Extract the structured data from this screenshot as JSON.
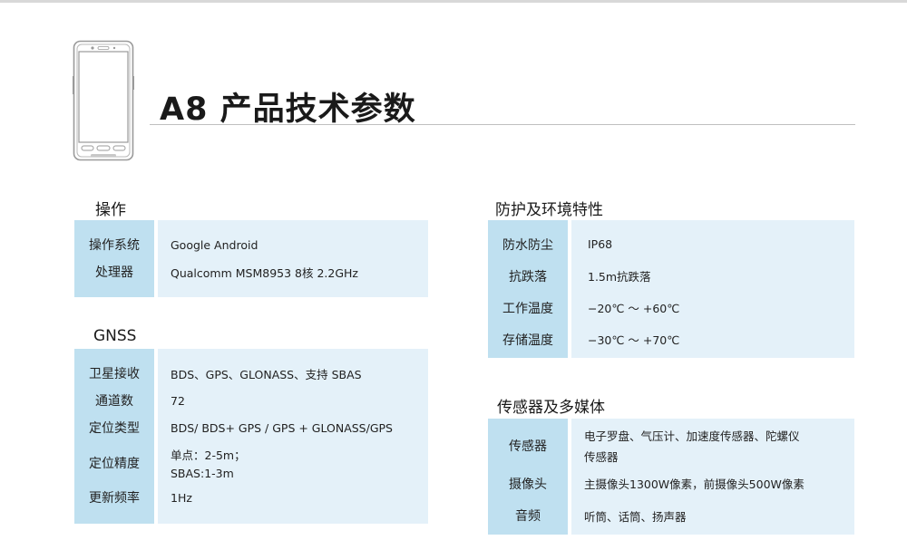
{
  "header": {
    "title": "A8 产品技术参数"
  },
  "sections": {
    "operation": {
      "title": "操作",
      "rows": [
        {
          "label": "操作系统",
          "value": "Google Android"
        },
        {
          "label": "处理器",
          "value": "Qualcomm MSM8953 8核  2.2GHz"
        }
      ]
    },
    "gnss": {
      "title": "GNSS",
      "rows": [
        {
          "label": "卫星接收",
          "value": "BDS、GPS、GLONASS、支持 SBAS"
        },
        {
          "label": "通道数",
          "value": "72"
        },
        {
          "label": "定位类型",
          "value": "BDS/ BDS+ GPS / GPS + GLONASS/GPS"
        },
        {
          "label": "定位精度",
          "value_line1": "单点：2-5m；",
          "value_line2": "SBAS:1-3m"
        },
        {
          "label": "更新频率",
          "value": "1Hz"
        }
      ]
    },
    "protection": {
      "title": "防护及环境特性",
      "rows": [
        {
          "label": "防水防尘",
          "value": "IP68"
        },
        {
          "label": "抗跌落",
          "value": "1.5m抗跌落"
        },
        {
          "label": "工作温度",
          "value": "−20℃ ～ +60℃"
        },
        {
          "label": "存储温度",
          "value": "−30℃ ～ +70℃"
        }
      ]
    },
    "sensors": {
      "title": "传感器及多媒体",
      "rows": [
        {
          "label": "传感器",
          "value_line1": "电子罗盘、气压计、加速度传感器、陀螺仪",
          "value_line2": "传感器"
        },
        {
          "label": "摄像头",
          "value": "主摄像头1300W像素，前摄像头500W像素"
        },
        {
          "label": "音频",
          "value": "听筒、话筒、扬声器"
        }
      ]
    }
  }
}
